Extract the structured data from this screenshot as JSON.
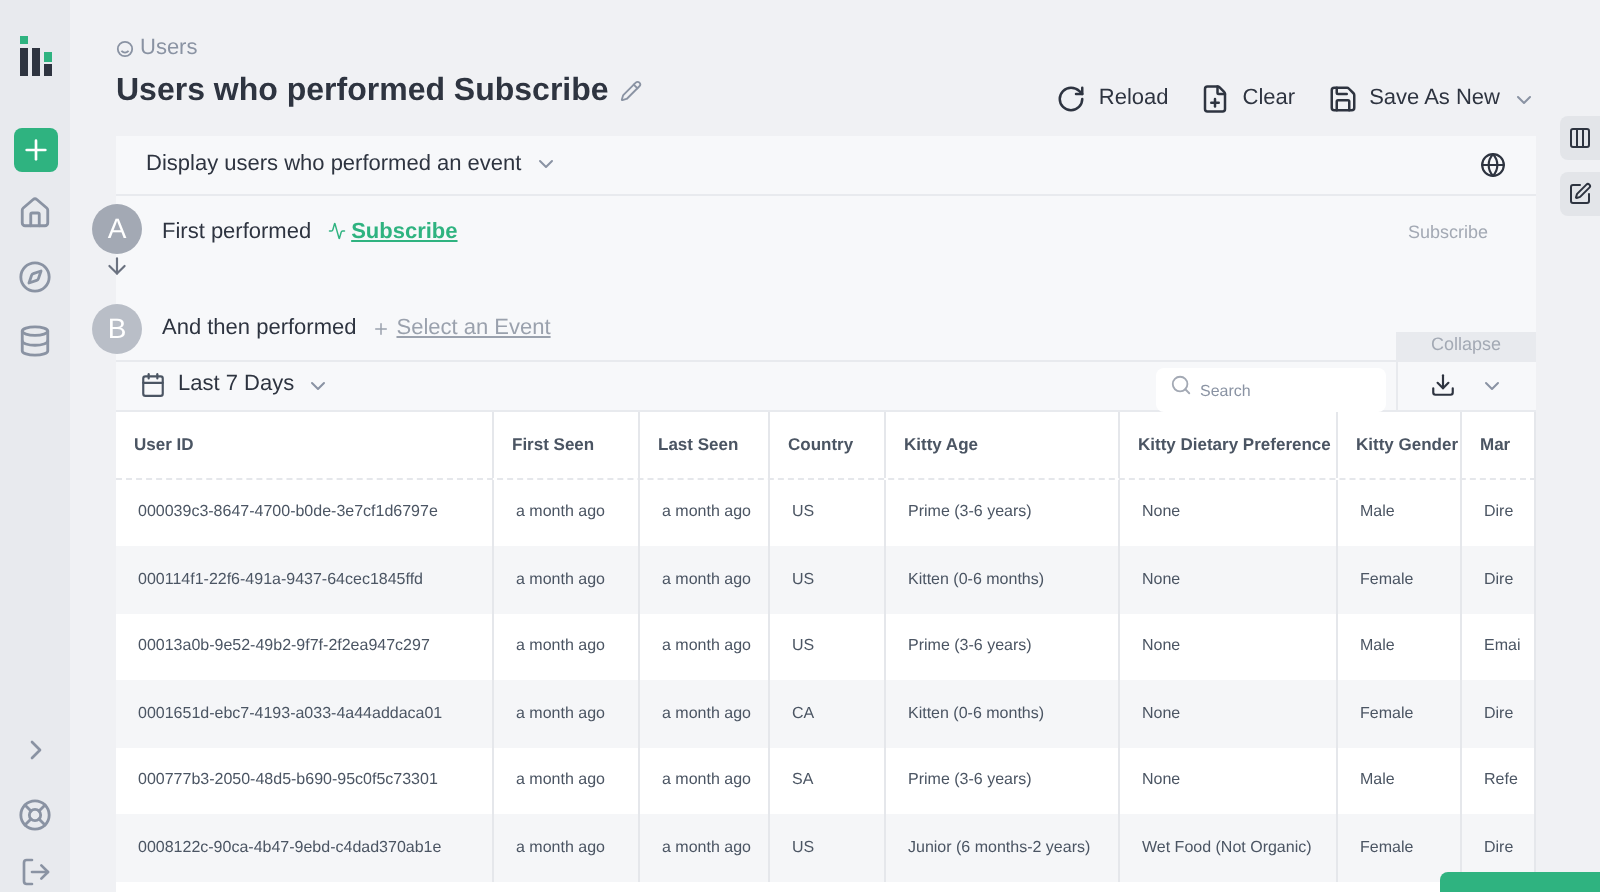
{
  "breadcrumb": "Users",
  "title": "Users who performed Subscribe",
  "actions": [
    {
      "kind": "reload",
      "label": "Reload"
    },
    {
      "kind": "clear",
      "label": "Clear"
    },
    {
      "kind": "save",
      "label": "Save As New"
    }
  ],
  "query": {
    "mode": "Display users who performed an event",
    "steps": [
      {
        "letter": "A",
        "label": "First performed",
        "event": "Subscribe",
        "selected": true,
        "side_label": "Subscribe"
      },
      {
        "letter": "B",
        "label": "And then performed",
        "event": "Select an Event",
        "selected": false
      }
    ],
    "collapse": "Collapse"
  },
  "filter": {
    "date_range": "Last 7 Days",
    "search_placeholder": "Search"
  },
  "table": {
    "columns": [
      "User ID",
      "First Seen",
      "Last Seen",
      "Country",
      "Kitty Age",
      "Kitty Dietary Preference",
      "Kitty Gender",
      "Mar"
    ],
    "rows": [
      [
        "000039c3-8647-4700-b0de-3e7cf1d6797e",
        "a month ago",
        "a month ago",
        "US",
        "Prime (3-6 years)",
        "None",
        "Male",
        "Dire"
      ],
      [
        "000114f1-22f6-491a-9437-64cec1845ffd",
        "a month ago",
        "a month ago",
        "US",
        "Kitten (0-6 months)",
        "None",
        "Female",
        "Dire"
      ],
      [
        "00013a0b-9e52-49b2-9f7f-2f2ea947c297",
        "a month ago",
        "a month ago",
        "US",
        "Prime (3-6 years)",
        "None",
        "Male",
        "Emai"
      ],
      [
        "0001651d-ebc7-4193-a033-4a44addaca01",
        "a month ago",
        "a month ago",
        "CA",
        "Kitten (0-6 months)",
        "None",
        "Female",
        "Dire"
      ],
      [
        "000777b3-2050-48d5-b690-95c0f5c73301",
        "a month ago",
        "a month ago",
        "SA",
        "Prime (3-6 years)",
        "None",
        "Male",
        "Refe"
      ],
      [
        "0008122c-90ca-4b47-9ebd-c4dad370ab1e",
        "a month ago",
        "a month ago",
        "US",
        "Junior (6 months-2 years)",
        "Wet Food (Not Organic)",
        "Female",
        "Dire"
      ]
    ]
  }
}
